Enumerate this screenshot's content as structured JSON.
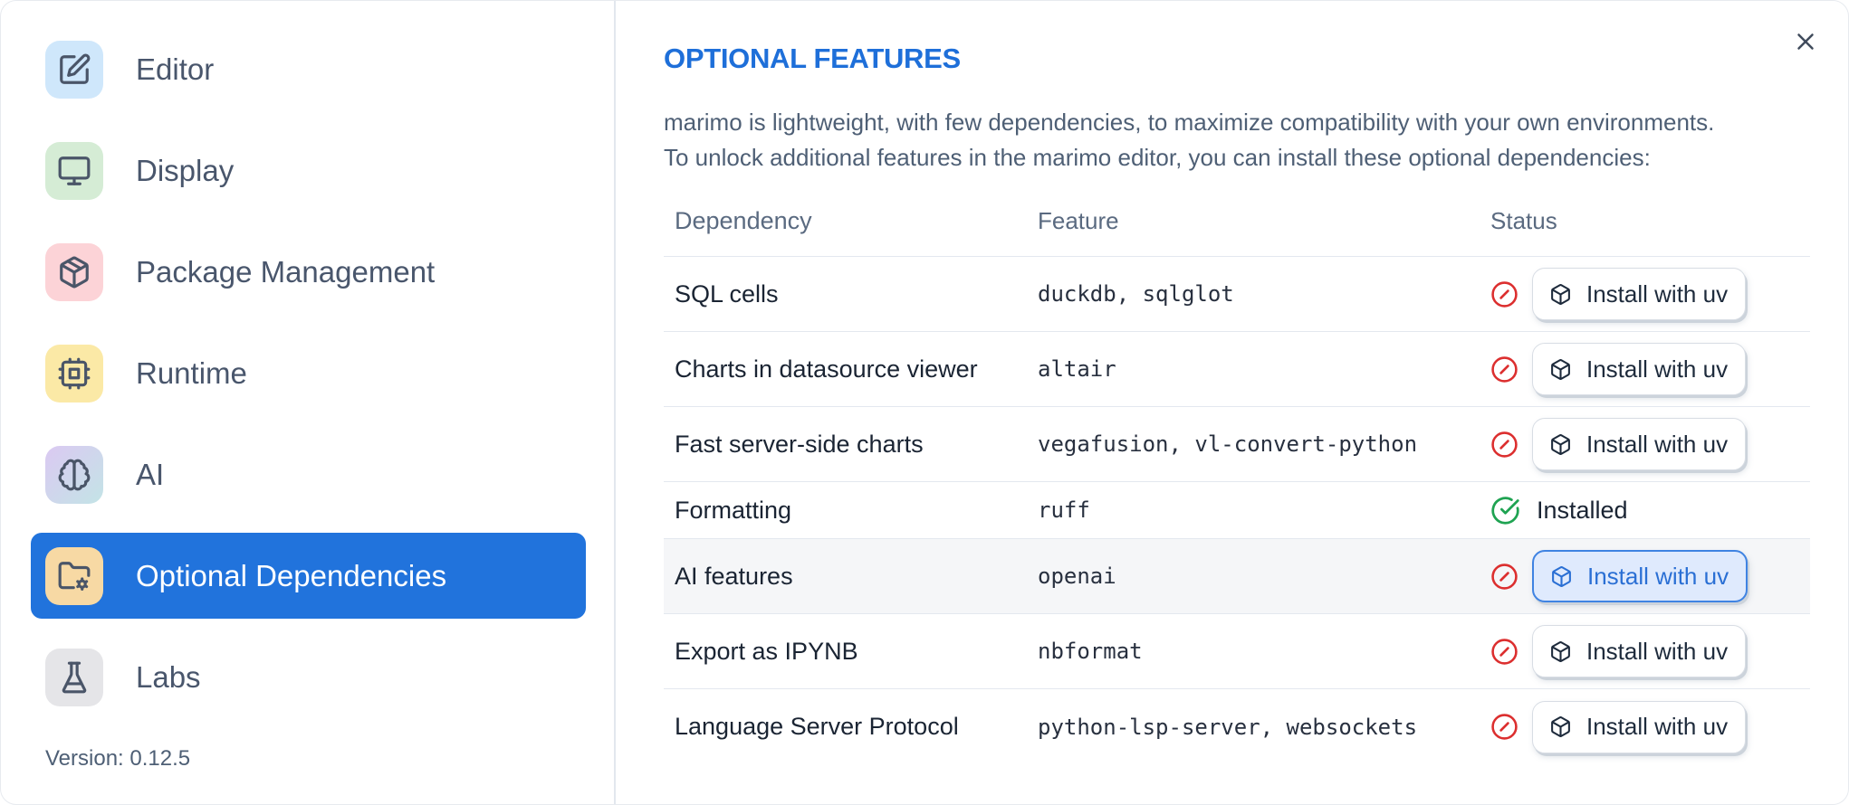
{
  "colors": {
    "selected_blue": "#2173dc",
    "title_blue": "#1e6fd9",
    "accent_blue": "#2a6fd4",
    "error_red": "#dc2f2f",
    "success_green": "#1fa352"
  },
  "sidebar": {
    "items": [
      {
        "key": "editor",
        "label": "Editor",
        "icon": "edit-icon",
        "symbol": "i-edit",
        "tile_bg": "#cfe7fb",
        "selected": false
      },
      {
        "key": "display",
        "label": "Display",
        "icon": "monitor-icon",
        "symbol": "i-monitor",
        "tile_bg": "#d5ecd5",
        "selected": false
      },
      {
        "key": "package-management",
        "label": "Package Management",
        "icon": "package-icon",
        "symbol": "i-package",
        "tile_bg": "#fcd3d7",
        "selected": false
      },
      {
        "key": "runtime",
        "label": "Runtime",
        "icon": "cpu-icon",
        "symbol": "i-cpu",
        "tile_bg": "#fbe9a6",
        "selected": false
      },
      {
        "key": "ai",
        "label": "AI",
        "icon": "brain-icon",
        "symbol": "i-brain",
        "tile_bg": "linear-gradient(135deg,#dbc9f2 0%,#c3e4e6 100%)",
        "selected": false
      },
      {
        "key": "optional-dependencies",
        "label": "Optional Dependencies",
        "icon": "folder-cog-icon",
        "symbol": "i-folder-cog",
        "tile_bg": "#f7d9a4",
        "selected": true
      },
      {
        "key": "labs",
        "label": "Labs",
        "icon": "flask-icon",
        "symbol": "i-flask",
        "tile_bg": "#e5e5e8",
        "selected": false
      }
    ],
    "version_label": "Version: 0.12.5"
  },
  "main": {
    "title": "OPTIONAL FEATURES",
    "description_line1": "marimo is lightweight, with few dependencies, to maximize compatibility with your own environments.",
    "description_line2": "To unlock additional features in the marimo editor, you can install these optional dependencies:",
    "table": {
      "columns": [
        "Dependency",
        "Feature",
        "Status"
      ],
      "rows": [
        {
          "dependency": "SQL cells",
          "feature": "duckdb, sqlglot",
          "status": "missing",
          "action_label": "Install with uv",
          "highlighted": false
        },
        {
          "dependency": "Charts in datasource viewer",
          "feature": "altair",
          "status": "missing",
          "action_label": "Install with uv",
          "highlighted": false
        },
        {
          "dependency": "Fast server-side charts",
          "feature": "vegafusion, vl-convert-python",
          "status": "missing",
          "action_label": "Install with uv",
          "highlighted": false
        },
        {
          "dependency": "Formatting",
          "feature": "ruff",
          "status": "installed",
          "status_label": "Installed",
          "highlighted": false
        },
        {
          "dependency": "AI features",
          "feature": "openai",
          "status": "missing",
          "action_label": "Install with uv",
          "highlighted": true
        },
        {
          "dependency": "Export as IPYNB",
          "feature": "nbformat",
          "status": "missing",
          "action_label": "Install with uv",
          "highlighted": false
        },
        {
          "dependency": "Language Server Protocol",
          "feature": "python-lsp-server, websockets",
          "status": "missing",
          "action_label": "Install with uv",
          "highlighted": false
        }
      ]
    }
  }
}
